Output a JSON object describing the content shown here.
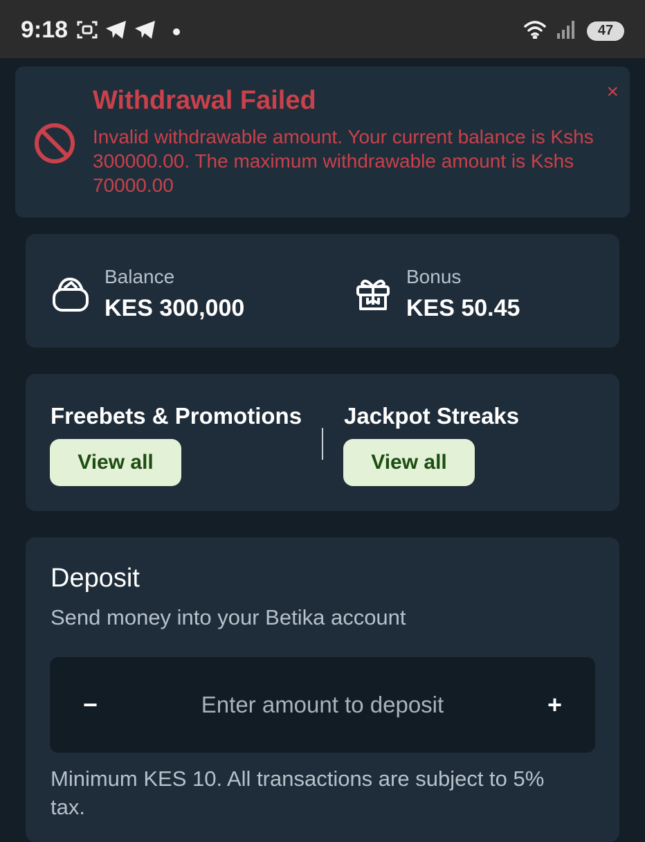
{
  "status_bar": {
    "time": "9:18",
    "battery": "47",
    "left_icons": [
      "screenshot-icon",
      "telegram-icon",
      "telegram-icon"
    ],
    "right_icons": [
      "wifi-icon",
      "signal-icon"
    ]
  },
  "alert": {
    "title": "Withdrawal Failed",
    "message": "Invalid withdrawable amount. Your current balance is Kshs 300000.00. The maximum withdrawable amount is Kshs 70000.00",
    "close": "×",
    "icon": "prohibited-icon",
    "color": "#c9414a"
  },
  "wallet": {
    "balance_label": "Balance",
    "balance_value": "KES 300,000",
    "bonus_label": "Bonus",
    "bonus_value": "KES 50.45",
    "balance_icon": "wallet-icon",
    "bonus_icon": "gift-icon"
  },
  "promos": {
    "freebets_title": "Freebets & Promotions",
    "freebets_button": "View all",
    "jackpot_title": "Jackpot Streaks",
    "jackpot_button": "View all",
    "button_color": "#e3f1d6"
  },
  "deposit": {
    "title": "Deposit",
    "subtitle": "Send money into your Betika account",
    "minus": "−",
    "plus": "+",
    "placeholder": "Enter amount to deposit",
    "note": "Minimum KES 10. All transactions are subject to 5% tax."
  }
}
